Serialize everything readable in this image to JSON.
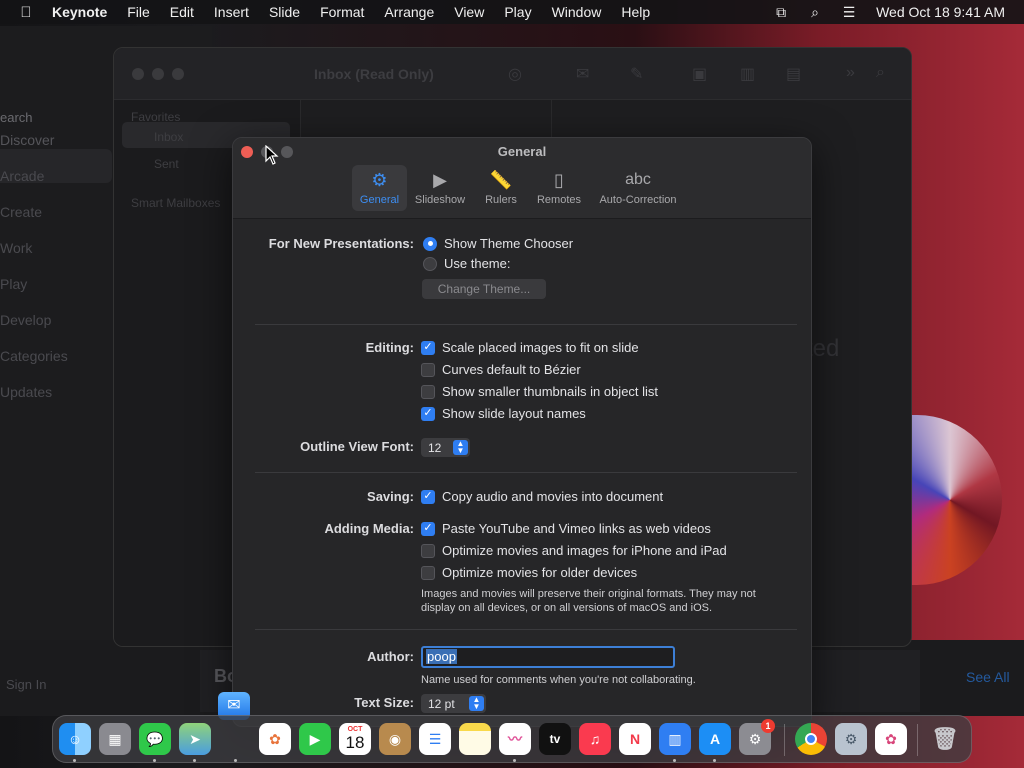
{
  "menubar": {
    "app_name": "Keynote",
    "menus": [
      "File",
      "Edit",
      "Insert",
      "Slide",
      "Format",
      "Arrange",
      "View",
      "Play",
      "Window",
      "Help"
    ],
    "clock": "Wed Oct 18  9:41 AM",
    "status_icons": [
      "screen-mirroring-icon",
      "spotlight-search-icon",
      "control-center-icon"
    ]
  },
  "appstore": {
    "search_placeholder": "earch",
    "sidebar": [
      "Discover",
      "Arcade",
      "Create",
      "Work",
      "Play",
      "Develop",
      "Categories",
      "Updates"
    ],
    "sign_in": "Sign In",
    "see_all": "See All",
    "bottom_heading": "Bo"
  },
  "mail": {
    "title": "Inbox (Read Only)",
    "favorites_heading": "Favorites",
    "inbox": "Inbox",
    "sent": "Sent",
    "smart_mailboxes": "Smart Mailboxes",
    "no_selection": "cted"
  },
  "prefs": {
    "window_title": "General",
    "tabs": [
      {
        "label": "General",
        "icon": "gear-icon",
        "active": true
      },
      {
        "label": "Slideshow",
        "icon": "play-icon",
        "active": false
      },
      {
        "label": "Rulers",
        "icon": "ruler-icon",
        "active": false
      },
      {
        "label": "Remotes",
        "icon": "remote-icon",
        "active": false
      },
      {
        "label": "Auto-Correction",
        "icon": "abc-icon",
        "active": false
      }
    ],
    "new_presentations": {
      "label": "For New Presentations:",
      "show_theme_chooser": "Show Theme Chooser",
      "use_theme": "Use theme:",
      "change_theme": "Change Theme...",
      "selected": "show_theme_chooser"
    },
    "editing": {
      "label": "Editing:",
      "options": [
        {
          "text": "Scale placed images to fit on slide",
          "checked": true
        },
        {
          "text": "Curves default to Bézier",
          "checked": false
        },
        {
          "text": "Show smaller thumbnails in object list",
          "checked": false
        },
        {
          "text": "Show slide layout names",
          "checked": true
        }
      ]
    },
    "outline_font": {
      "label": "Outline View Font:",
      "value": "12"
    },
    "saving": {
      "label": "Saving:",
      "text": "Copy audio and movies into document",
      "checked": true
    },
    "adding_media": {
      "label": "Adding Media:",
      "options": [
        {
          "text": "Paste YouTube and Vimeo links as web videos",
          "checked": true
        },
        {
          "text": "Optimize movies and images for iPhone and iPad",
          "checked": false
        },
        {
          "text": "Optimize movies for older devices",
          "checked": false
        }
      ],
      "note_line1": "Images and movies will preserve their original formats. They may not",
      "note_line2": "display on all devices, or on all versions of macOS and iOS."
    },
    "author": {
      "label": "Author:",
      "value": "poop",
      "note": "Name used for comments when you're not collaborating."
    },
    "text_size": {
      "label": "Text Size:",
      "value": "12 pt"
    }
  },
  "dock": {
    "apps": [
      "Finder",
      "Launchpad",
      "Messages",
      "Maps",
      "Photos",
      "FaceTime",
      "Calendar",
      "Contacts",
      "Reminders",
      "Notes",
      "Freeform",
      "TV",
      "Music",
      "News",
      "Keynote",
      "App Store",
      "System Settings",
      "Chrome",
      "Utilities",
      "Photos",
      "Trash"
    ],
    "calendar_month": "OCT",
    "calendar_day": "18",
    "tv_label": "tv",
    "settings_badge": "1"
  }
}
